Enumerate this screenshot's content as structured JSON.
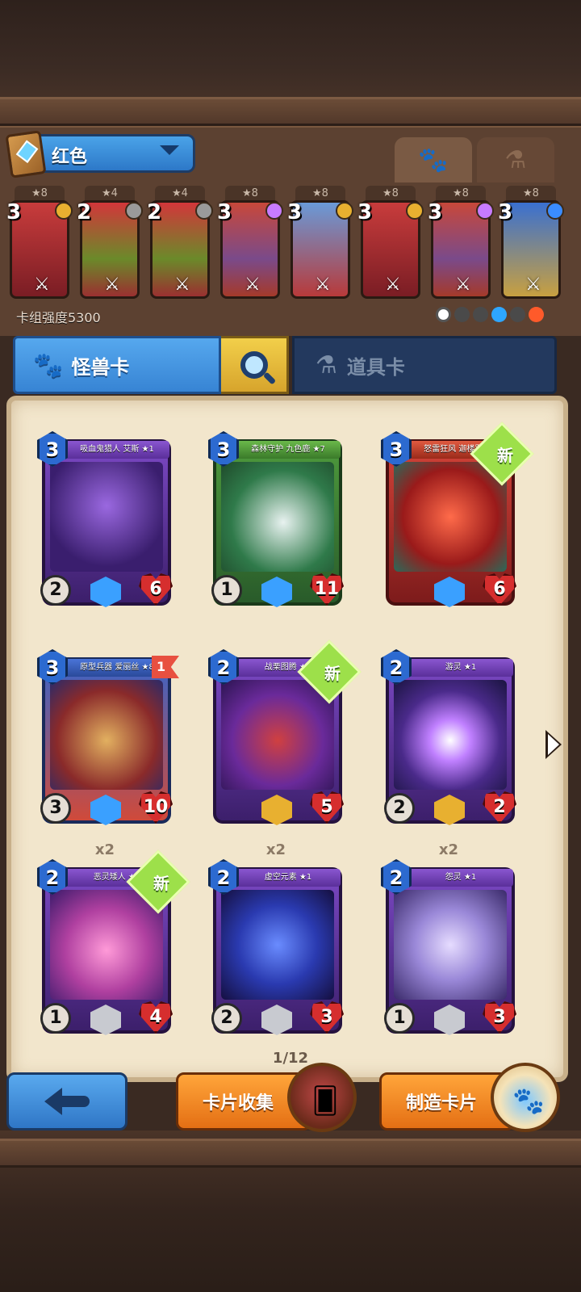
{
  "deck": {
    "name": "红色",
    "power_label": "卡组强度5300",
    "tabs": {
      "monster_icon": "paw-icon",
      "item_icon": "potion-icon"
    },
    "cards": [
      {
        "stars": "★8",
        "cost": "3",
        "gem_color": "#e8b030",
        "art": "red"
      },
      {
        "stars": "★4",
        "cost": "2",
        "gem_color": "#9a9a9a",
        "art": "green"
      },
      {
        "stars": "★4",
        "cost": "2",
        "gem_color": "#9a9a9a",
        "art": "green"
      },
      {
        "stars": "★8",
        "cost": "3",
        "gem_color": "#c77bff",
        "art": "knight"
      },
      {
        "stars": "★8",
        "cost": "3",
        "gem_color": "#e8b030",
        "art": "bat"
      },
      {
        "stars": "★8",
        "cost": "3",
        "gem_color": "#e8b030",
        "art": "red"
      },
      {
        "stars": "★8",
        "cost": "3",
        "gem_color": "#c77bff",
        "art": "knight"
      },
      {
        "stars": "★8",
        "cost": "3",
        "gem_color": "#3a8cff",
        "art": "girl"
      }
    ],
    "elements": [
      "neutral-icon",
      "skull-icon",
      "leaf-icon",
      "water-icon",
      "wind-icon",
      "fire-icon"
    ]
  },
  "category_tabs": {
    "monster": "怪兽卡",
    "item": "道具卡"
  },
  "cards": [
    {
      "name": "吸血鬼猎人 艾斯 ★1",
      "cost": "3",
      "atk": "2",
      "hp": "6",
      "art": "vampire",
      "frame": "purple",
      "ribbon": "purple",
      "rarity": "star",
      "new": false,
      "copies": ""
    },
    {
      "name": "森林守护 九色鹿 ★7",
      "cost": "3",
      "atk": "1",
      "hp": "11",
      "art": "deer",
      "frame": "green",
      "ribbon": "green",
      "rarity": "star",
      "new": false,
      "copies": ""
    },
    {
      "name": "怒雷狂风 迦楼罗 ★1",
      "cost": "3",
      "atk": "",
      "hp": "6",
      "art": "dragon",
      "frame": "red",
      "ribbon": "red",
      "rarity": "star",
      "new": true,
      "copies": ""
    },
    {
      "name": "原型兵器 爱丽丝 ★8",
      "cost": "3",
      "atk": "3",
      "hp": "10",
      "art": "doll",
      "frame": "redblue",
      "ribbon": "blue",
      "rarity": "star",
      "new": false,
      "level": "1",
      "copies": ""
    },
    {
      "name": "战栗图腾 ★1",
      "cost": "2",
      "atk": "",
      "hp": "5",
      "art": "totem",
      "frame": "purple",
      "ribbon": "purple",
      "rarity": "gold",
      "new": true,
      "copies": ""
    },
    {
      "name": "游灵 ★1",
      "cost": "2",
      "atk": "2",
      "hp": "2",
      "art": "wisp",
      "frame": "purple",
      "ribbon": "purple",
      "rarity": "gold",
      "new": false,
      "copies": ""
    },
    {
      "name": "恶灵矮人 ★1",
      "cost": "2",
      "atk": "1",
      "hp": "4",
      "art": "dwarf",
      "frame": "purple",
      "ribbon": "purple",
      "rarity": "silver",
      "new": true,
      "copies": "x2"
    },
    {
      "name": "虚空元素 ★1",
      "cost": "2",
      "atk": "2",
      "hp": "3",
      "art": "void",
      "frame": "purple",
      "ribbon": "purple",
      "rarity": "silver",
      "new": false,
      "copies": "x2"
    },
    {
      "name": "怨灵 ★1",
      "cost": "2",
      "atk": "1",
      "hp": "3",
      "art": "ghost",
      "frame": "purple",
      "ribbon": "purple",
      "rarity": "silver",
      "new": false,
      "copies": "x2"
    }
  ],
  "new_label": "新",
  "page_indicator": "1/12",
  "buttons": {
    "back_icon": "back-arrow-icon",
    "collect": "卡片收集",
    "craft": "制造卡片"
  },
  "colors": {
    "accent_blue": "#3784d4",
    "accent_orange": "#e46f14",
    "parchment": "#f2e6cc"
  }
}
